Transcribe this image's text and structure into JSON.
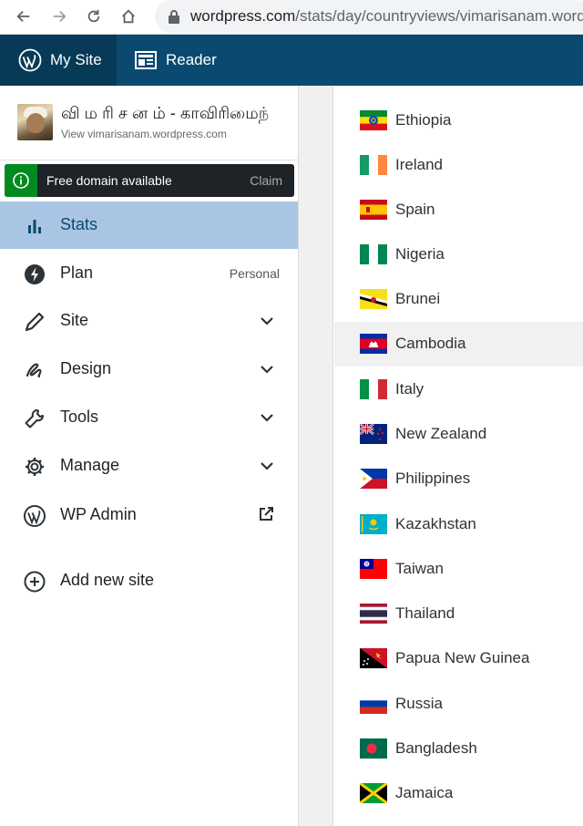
{
  "browser": {
    "url_host": "wordpress.com",
    "url_path": "/stats/day/countryviews/vimarisanam.word"
  },
  "masterbar": {
    "my_site": "My Site",
    "reader": "Reader"
  },
  "site": {
    "name": "வி ம ரி ச ன ம் - காவிரிமைந்",
    "url": "View vimarisanam.wordpress.com"
  },
  "notice": {
    "text": "Free domain available",
    "action": "Claim"
  },
  "menu": {
    "stats": "Stats",
    "plan": "Plan",
    "plan_badge": "Personal",
    "site": "Site",
    "design": "Design",
    "tools": "Tools",
    "manage": "Manage",
    "wp_admin": "WP Admin",
    "add_site": "Add new site"
  },
  "colors": {
    "masterbar": "#0b4a70",
    "active_item": "#a9c5e3",
    "notice_icon": "#008a20"
  },
  "countries": [
    {
      "name": "Ethiopia",
      "flag": "ethiopia-flag-icon"
    },
    {
      "name": "Ireland",
      "flag": "ireland-flag-icon"
    },
    {
      "name": "Spain",
      "flag": "spain-flag-icon"
    },
    {
      "name": "Nigeria",
      "flag": "nigeria-flag-icon"
    },
    {
      "name": "Brunei",
      "flag": "brunei-flag-icon"
    },
    {
      "name": "Cambodia",
      "flag": "cambodia-flag-icon"
    },
    {
      "name": "Italy",
      "flag": "italy-flag-icon"
    },
    {
      "name": "New Zealand",
      "flag": "new-zealand-flag-icon"
    },
    {
      "name": "Philippines",
      "flag": "philippines-flag-icon"
    },
    {
      "name": "Kazakhstan",
      "flag": "kazakhstan-flag-icon"
    },
    {
      "name": "Taiwan",
      "flag": "taiwan-flag-icon"
    },
    {
      "name": "Thailand",
      "flag": "thailand-flag-icon"
    },
    {
      "name": "Papua New Guinea",
      "flag": "papua-new-guinea-flag-icon"
    },
    {
      "name": "Russia",
      "flag": "russia-flag-icon"
    },
    {
      "name": "Bangladesh",
      "flag": "bangladesh-flag-icon"
    },
    {
      "name": "Jamaica",
      "flag": "jamaica-flag-icon"
    }
  ]
}
